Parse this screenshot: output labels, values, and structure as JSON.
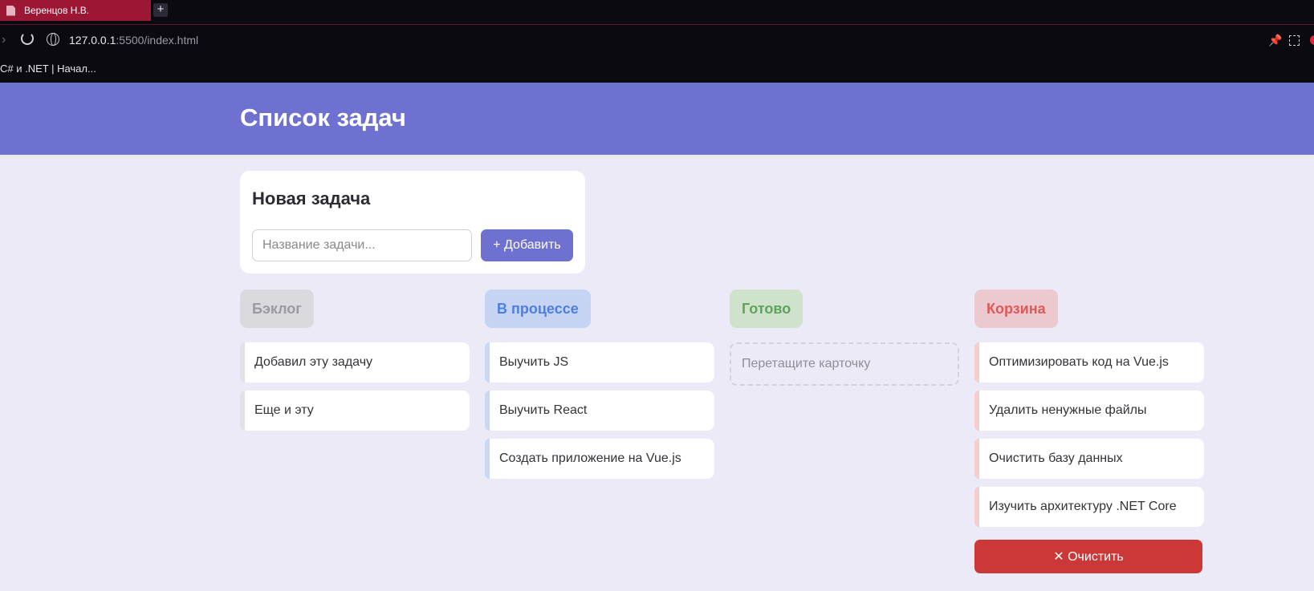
{
  "browser": {
    "tab_title": "Веренцов Н.В.",
    "new_tab": "+",
    "url_host": "127.0.0.1",
    "url_rest": ":5500/index.html",
    "bookmark": "C# и .NET | Начал..."
  },
  "app": {
    "title": "Список задач",
    "new_task": {
      "title": "Новая задача",
      "placeholder": "Название задачи...",
      "value": "",
      "add_label": "+ Добавить"
    },
    "columns": [
      {
        "key": "backlog",
        "title": "Бэклог",
        "color": "#9a9aa0",
        "bg": "#d9d9de",
        "accent": "#e2e2e6",
        "cards": [
          "Добавил эту задачу",
          "Еще и эту"
        ]
      },
      {
        "key": "progress",
        "title": "В процессе",
        "color": "#4d7fe0",
        "bg": "#c6d4f4",
        "accent": "#c9d8f5",
        "cards": [
          "Выучить JS",
          "Выучить React",
          "Создать приложение на Vue.js"
        ]
      },
      {
        "key": "done",
        "title": "Готово",
        "color": "#5ea35a",
        "bg": "#cfe3cc",
        "accent": "#cfe3cc",
        "cards": [],
        "empty_text": "Перетащите карточку"
      },
      {
        "key": "trash",
        "title": "Корзина",
        "color": "#de5a5a",
        "bg": "#ecc8cf",
        "accent": "#f6cccc",
        "cards": [
          "Оптимизировать код на Vue.js",
          "Удалить ненужные файлы",
          "Очистить базу данных",
          "Изучить архитектуру .NET Core"
        ],
        "clear_label": "✕ Очистить"
      }
    ]
  }
}
